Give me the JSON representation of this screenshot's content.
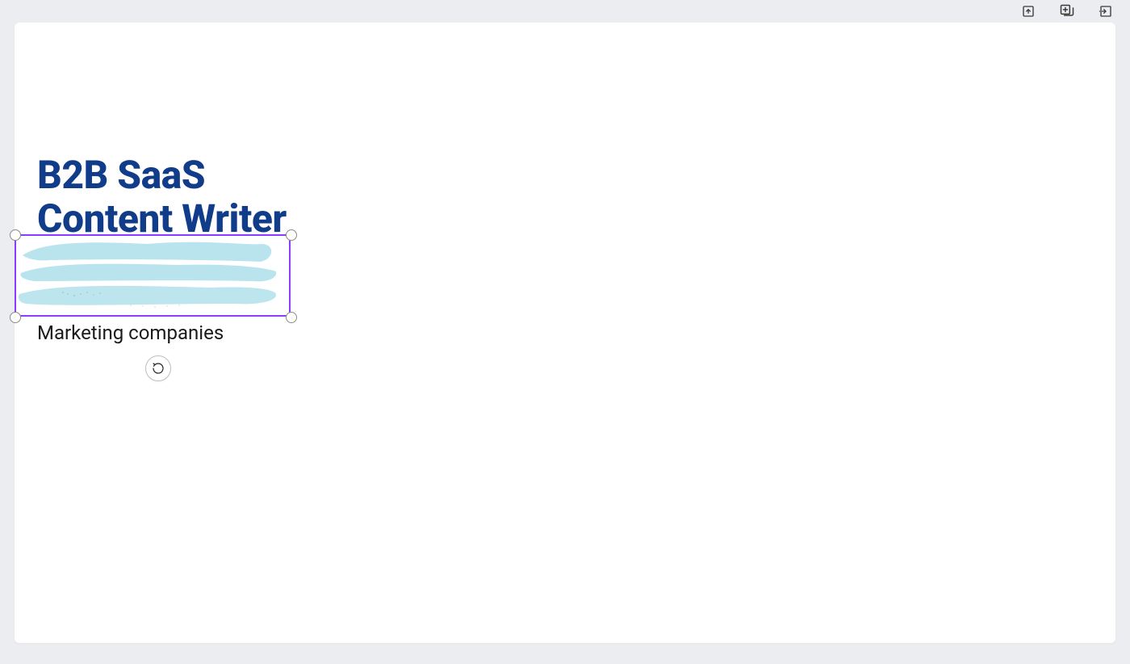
{
  "toolbar": {
    "icons": {
      "upload": "upload-icon",
      "duplicate": "duplicate-icon",
      "popout": "popout-icon"
    }
  },
  "canvas": {
    "heading": "B2B SaaS Content Writer",
    "subheading": "Marketing companies",
    "selection": {
      "border_color": "#8b3dff",
      "handle_fill": "#ffffff",
      "handle_border": "#8a8a8a"
    },
    "brush": {
      "fill": "#b3e1eb"
    },
    "heading_color": "#113c8a"
  }
}
